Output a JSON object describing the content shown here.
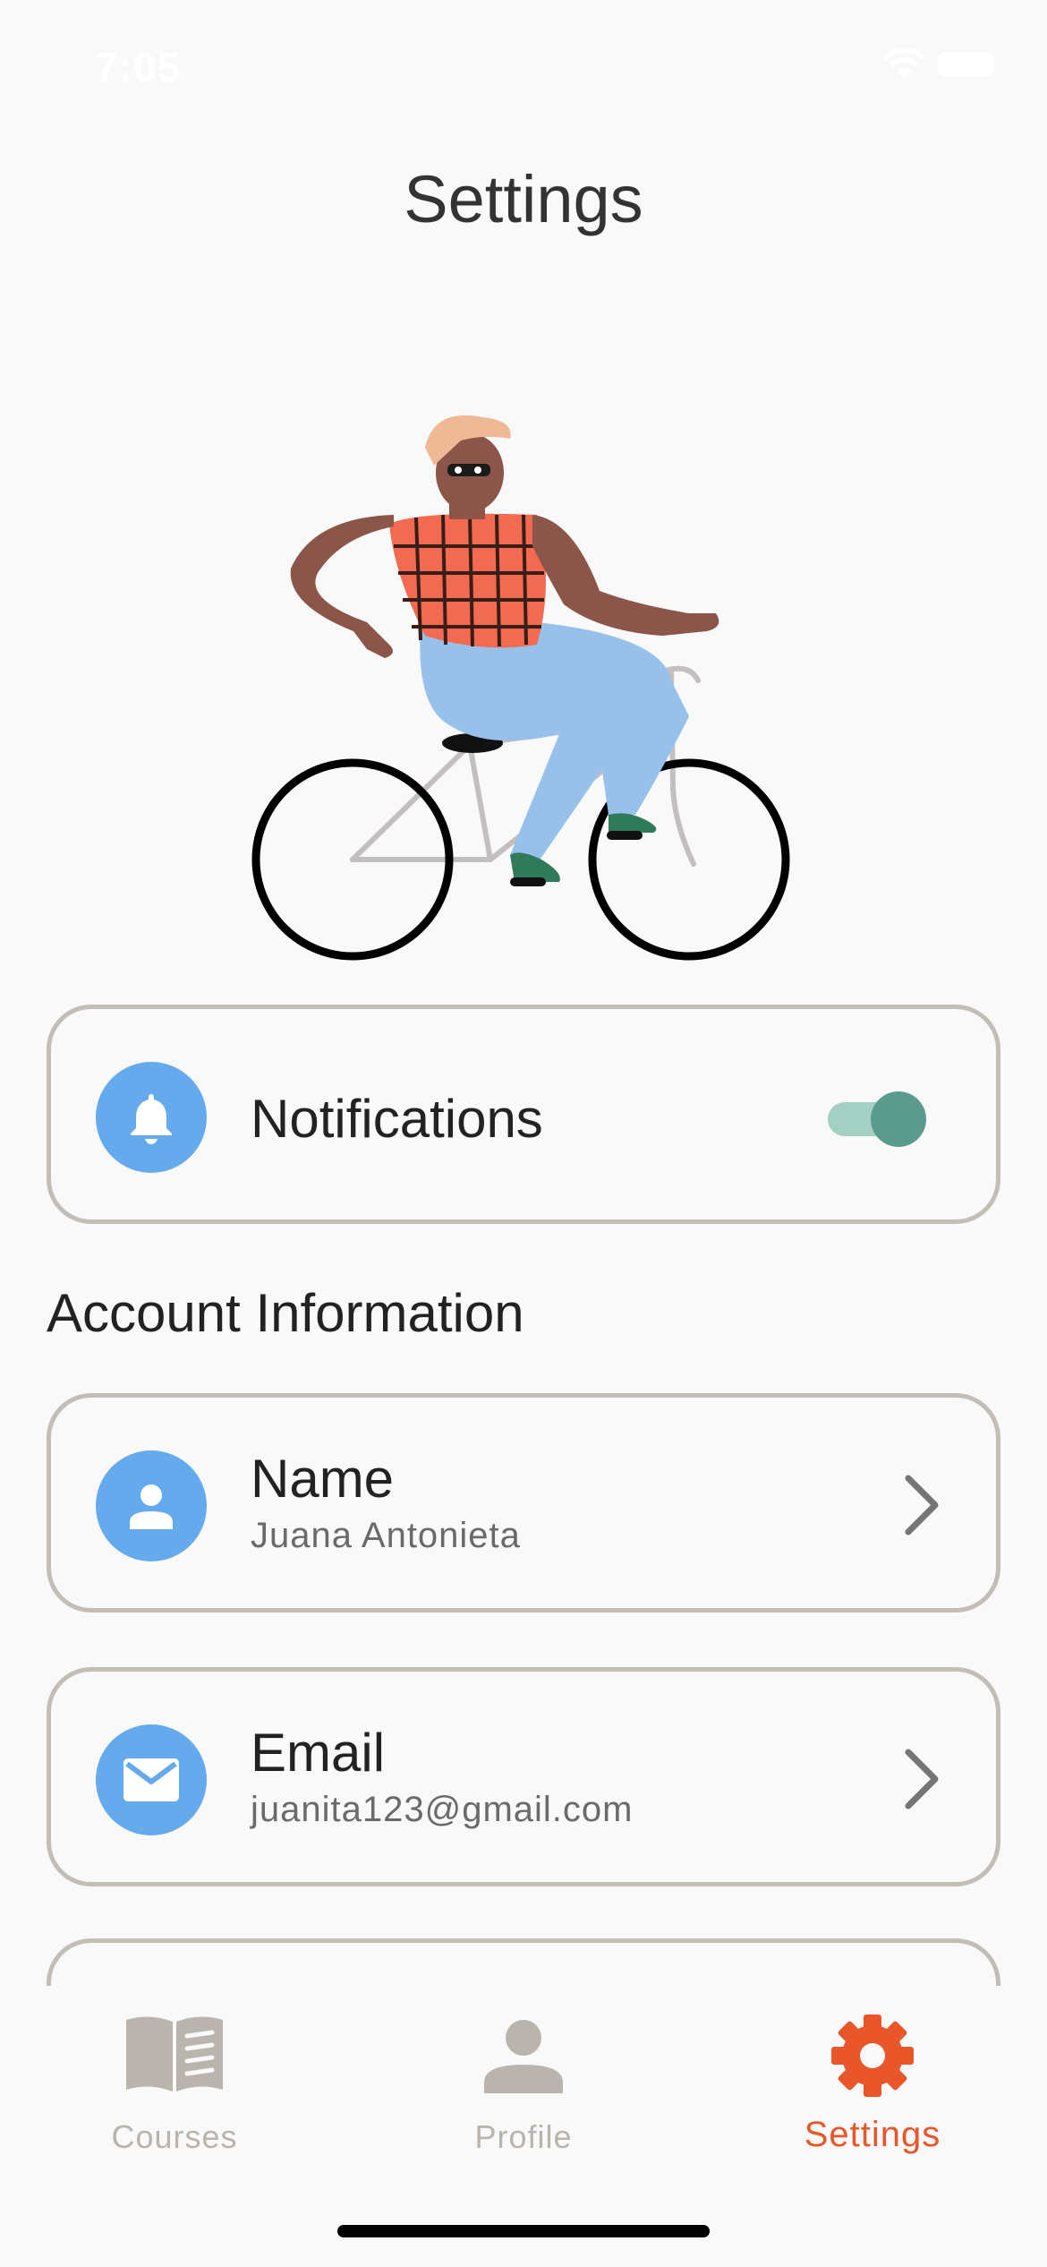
{
  "status_bar": {
    "time": "7:05"
  },
  "header": {
    "title": "Settings"
  },
  "notifications": {
    "label": "Notifications",
    "enabled": true,
    "icon": "bell-icon"
  },
  "account": {
    "section_title": "Account Information",
    "items": [
      {
        "title": "Name",
        "value": "Juana Antonieta",
        "icon": "person-icon"
      },
      {
        "title": "Email",
        "value": "juanita123@gmail.com",
        "icon": "mail-icon"
      }
    ]
  },
  "tab_bar": {
    "tabs": [
      {
        "label": "Courses",
        "icon": "book-icon",
        "active": false
      },
      {
        "label": "Profile",
        "icon": "person-icon",
        "active": false
      },
      {
        "label": "Settings",
        "icon": "gear-icon",
        "active": true
      }
    ]
  },
  "colors": {
    "accent": "#e8562a",
    "icon_circle": "#64aaec",
    "toggle_on": "#5b9b8d",
    "inactive_tab": "#b9b4ad",
    "card_border": "#c2bdb6"
  }
}
